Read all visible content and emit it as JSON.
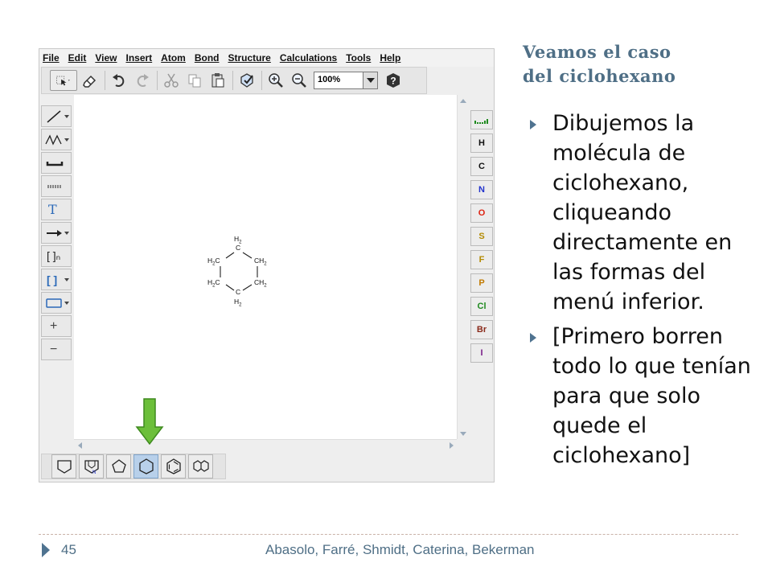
{
  "slide": {
    "title_line1": "Veamos el caso",
    "title_line2": "del ciclohexano",
    "bullets": [
      "Dibujemos la molécula de ciclohexano, cliqueando directamente en las formas del menú inferior.",
      "[Primero borren todo lo que tenían para que solo quede el ciclohexano]"
    ],
    "page_number": "45",
    "footer_authors": "Abasolo, Farré, Shmidt, Caterina, Bekerman"
  },
  "app": {
    "menu": [
      "File",
      "Edit",
      "View",
      "Insert",
      "Atom",
      "Bond",
      "Structure",
      "Calculations",
      "Tools",
      "Help"
    ],
    "zoom_value": "100%",
    "toolbar_icons": [
      "select-icon",
      "eraser-icon",
      "undo-icon",
      "redo-icon",
      "cut-icon",
      "copy-icon",
      "paste-icon",
      "clean-icon",
      "zoom-in-icon",
      "zoom-out-icon",
      "help-icon"
    ],
    "left_tools": {
      "text_tool_label": "T",
      "bracket_label": "[ ]",
      "sgroup_label": "[ ]ₙ",
      "plus_label": "+",
      "minus_label": "−"
    },
    "atoms": [
      {
        "symbol": "H",
        "color": "#111111"
      },
      {
        "symbol": "C",
        "color": "#111111"
      },
      {
        "symbol": "N",
        "color": "#2233cc"
      },
      {
        "symbol": "O",
        "color": "#dd2211"
      },
      {
        "symbol": "S",
        "color": "#b38a00"
      },
      {
        "symbol": "F",
        "color": "#b38a00"
      },
      {
        "symbol": "P",
        "color": "#c27a00"
      },
      {
        "symbol": "Cl",
        "color": "#1f8a1f"
      },
      {
        "symbol": "Br",
        "color": "#8a2a1a"
      },
      {
        "symbol": "I",
        "color": "#7a1f8a"
      }
    ],
    "molecule": {
      "top_h": "H",
      "top_h_sub": "2",
      "top_c": "C",
      "left_upper_h": "H",
      "left_upper_sub": "2",
      "left_upper_c": "C",
      "right_upper_c": "CH",
      "right_upper_sub": "2",
      "left_lower_h": "H",
      "left_lower_sub": "2",
      "left_lower_c": "C",
      "right_lower_c": "CH",
      "right_lower_sub": "2",
      "bottom_c": "C",
      "bottom_h": "H",
      "bottom_h_sub": "2"
    },
    "templates": [
      "benzene-house-icon",
      "n-ring-icon",
      "cyclopentane-icon",
      "cyclohexane-icon",
      "benzene-icon",
      "naphthalene-icon"
    ],
    "active_template": "cyclohexane-icon",
    "n_label": "N",
    "colors": {
      "accent": "#4f7390",
      "title": "#4f6f86",
      "active_template": "#b8d0ea",
      "arrow_green": "#6cbf3a"
    }
  }
}
